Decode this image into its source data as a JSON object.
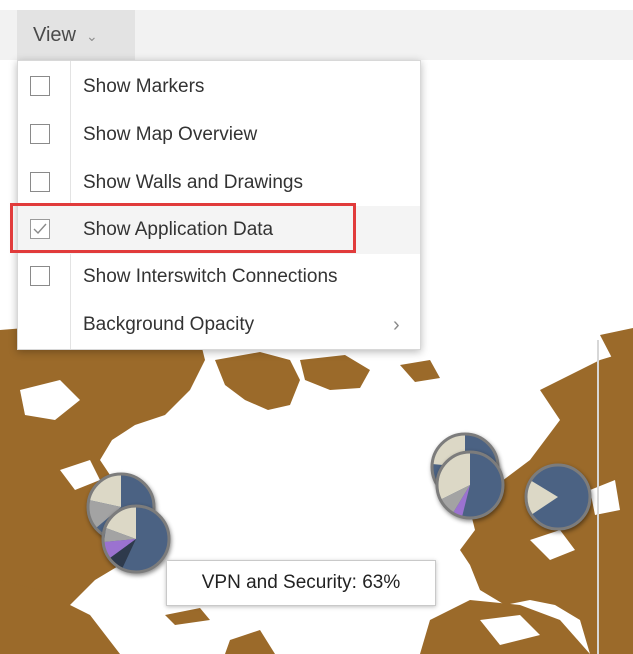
{
  "toolbar": {
    "view_label": "View",
    "view_chevron": "chevron-down-icon"
  },
  "menu": {
    "items": [
      {
        "label": "Show Markers",
        "checked": false
      },
      {
        "label": "Show Map Overview",
        "checked": false
      },
      {
        "label": "Show Walls and Drawings",
        "checked": false
      },
      {
        "label": "Show Application Data",
        "checked": true
      },
      {
        "label": "Show Interswitch Connections",
        "checked": false
      },
      {
        "label": "Background Opacity",
        "submenu_icon": "chevron-right-icon"
      }
    ]
  },
  "tooltip": {
    "text": "VPN and Security: 63%"
  },
  "colors": {
    "land": "#9b6a2a",
    "water": "#ffffff",
    "pie_dark": "#4b6283",
    "pie_light": "#dcd8c6",
    "pie_purple": "#9b72d0",
    "pie_gray": "#a3a3a3",
    "highlight": "#e13b3b"
  }
}
